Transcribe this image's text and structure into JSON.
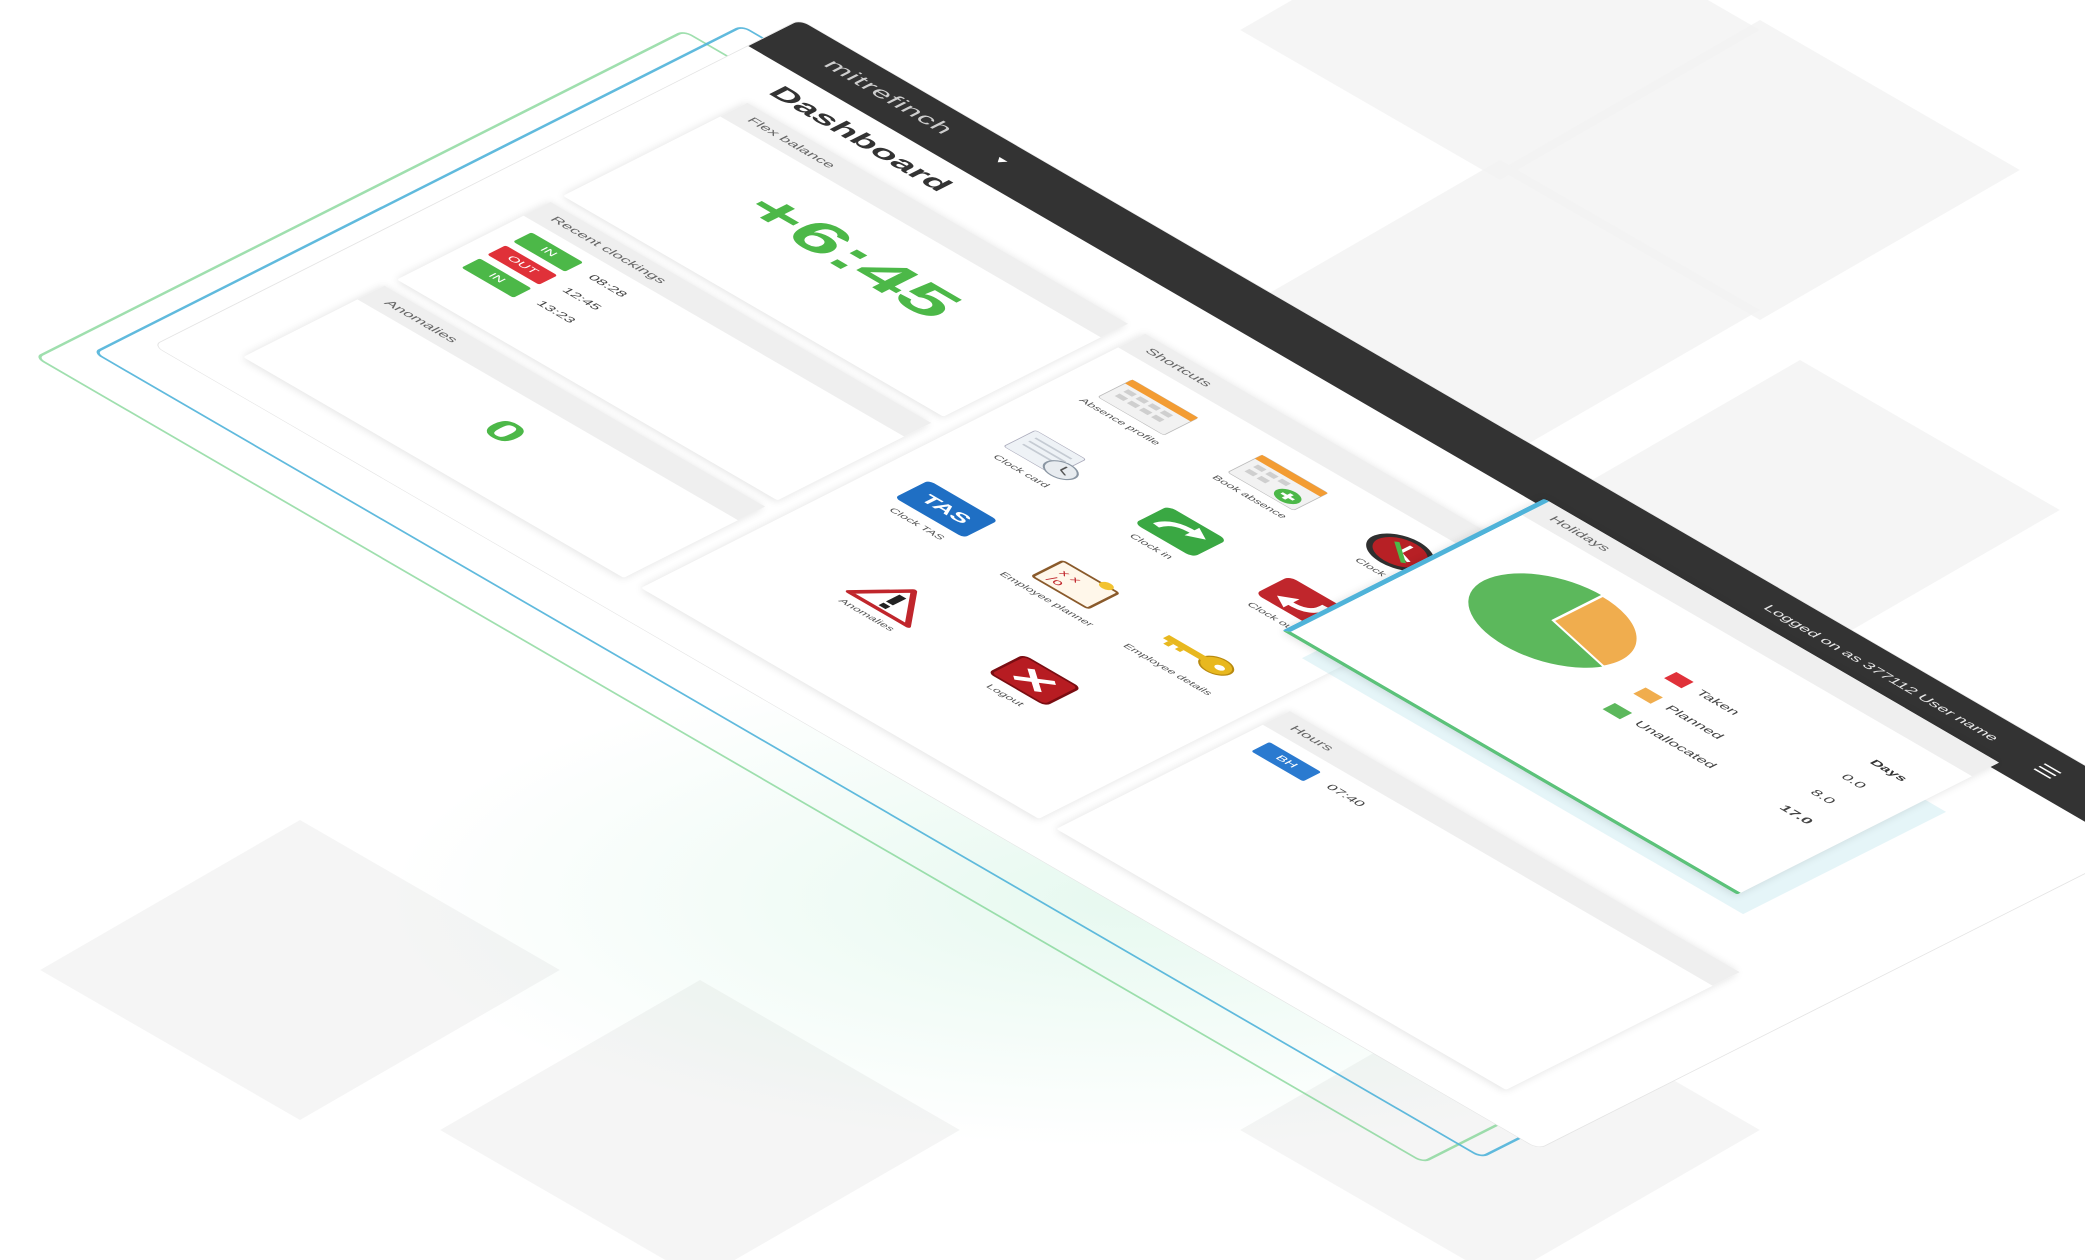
{
  "header": {
    "brand": "mitrefinch",
    "user_info": "Logged on as 377112 User name",
    "help_label": "?"
  },
  "page_title": "Dashboard",
  "flex": {
    "title": "Flex balance",
    "value": "+6:45"
  },
  "recent_clockings": {
    "title": "Recent clockings",
    "rows": [
      {
        "type": "IN",
        "time": "08:28"
      },
      {
        "type": "OUT",
        "time": "12:45"
      },
      {
        "type": "IN",
        "time": "13:23"
      }
    ]
  },
  "anomalies": {
    "title": "Anomalies",
    "value": "0"
  },
  "shortcuts": {
    "title": "Shortcuts",
    "items": [
      {
        "label": "Absence profile",
        "icon": "calendar-icon"
      },
      {
        "label": "Book absence",
        "icon": "calendar-add-icon"
      },
      {
        "label": "Clock",
        "icon": "clock-icon"
      },
      {
        "label": "Clock card",
        "icon": "clock-card-icon"
      },
      {
        "label": "Clock in",
        "icon": "clock-in-arrow-icon"
      },
      {
        "label": "Clock out",
        "icon": "clock-out-arrow-icon"
      },
      {
        "label": "Clock TAS",
        "icon": "tas-icon"
      },
      {
        "label": "Employee planner",
        "icon": "planner-icon"
      },
      {
        "label": "Employee details",
        "icon": "key-icon"
      },
      {
        "label": "Anomalies",
        "icon": "warning-icon"
      },
      {
        "label": "Logout",
        "icon": "logout-icon"
      }
    ],
    "tas_text": "TAS"
  },
  "holidays": {
    "title": "Holidays",
    "days_header": "Days",
    "legend": [
      {
        "label": "Taken",
        "value": "0.0",
        "color": "#e03139"
      },
      {
        "label": "Planned",
        "value": "8.0",
        "color": "#f0ad4e"
      },
      {
        "label": "Unallocated",
        "value": "17.0",
        "color": "#5cb85c"
      }
    ]
  },
  "hours": {
    "title": "Hours",
    "rows": [
      {
        "type": "BH",
        "time": "07:40"
      }
    ]
  }
}
